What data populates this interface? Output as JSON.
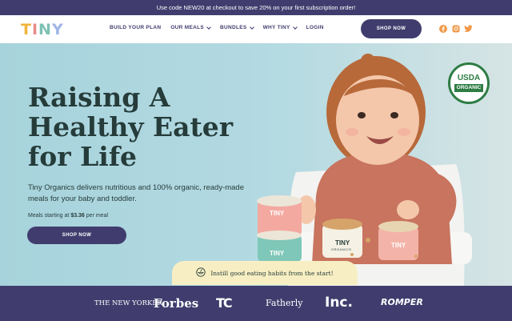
{
  "promo": {
    "text": "Use code NEW20 at checkout to save 20% on your first subscription order!"
  },
  "logo": {
    "letters": [
      "T",
      "I",
      "N",
      "Y"
    ],
    "colors": [
      "#f0b43c",
      "#e98a8a",
      "#7dc2b4",
      "#9fb6e6"
    ]
  },
  "nav": {
    "items": [
      {
        "label": "BUILD YOUR PLAN",
        "dropdown": false
      },
      {
        "label": "OUR MEALS",
        "dropdown": true
      },
      {
        "label": "BUNDLES",
        "dropdown": true
      },
      {
        "label": "WHY TINY",
        "dropdown": true
      },
      {
        "label": "LOGIN",
        "dropdown": false
      }
    ],
    "cta": "SHOP NOW"
  },
  "social": {
    "icons": [
      "facebook-icon",
      "instagram-icon",
      "twitter-icon"
    ],
    "color": "#f09a4a"
  },
  "hero": {
    "headline_line1": "Raising A",
    "headline_line2": "Healthy Eater",
    "headline_line3": "for Life",
    "subtitle": "Tiny Organics delivers nutritious and 100% organic, ready-made meals for your baby and toddler.",
    "price_prefix": "Meals starting at ",
    "price_value": "$3.36",
    "price_suffix": " per meal",
    "cta": "SHOP NOW",
    "usda_line1": "USDA",
    "usda_line2": "ORGANIC",
    "cup_label": "TINY",
    "cup_sublabel": "ORGANICS"
  },
  "badge": {
    "text": "Instill good eating habits from the start!",
    "icon": "spoon-bowl-icon"
  },
  "press": {
    "logos": [
      "THE NEW YORKER",
      "Forbes",
      "TC",
      "Fatherly",
      "Inc.",
      "ROMPER"
    ]
  },
  "colors": {
    "brand": "#403d6e",
    "hero_bg": "#a9d4dc",
    "text_dark": "#263c3a",
    "badge_bg": "#f7efc3"
  }
}
